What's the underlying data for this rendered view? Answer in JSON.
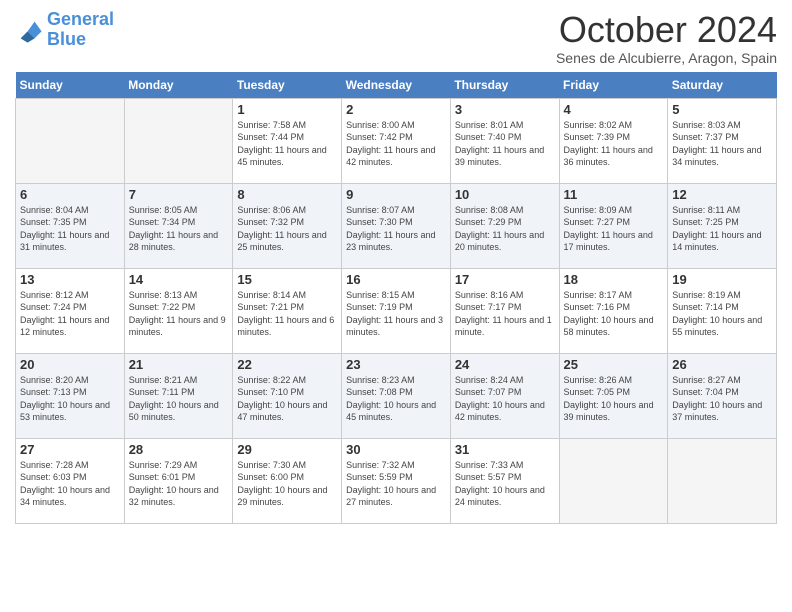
{
  "header": {
    "logo_line1": "General",
    "logo_line2": "Blue",
    "month": "October 2024",
    "location": "Senes de Alcubierre, Aragon, Spain"
  },
  "days_of_week": [
    "Sunday",
    "Monday",
    "Tuesday",
    "Wednesday",
    "Thursday",
    "Friday",
    "Saturday"
  ],
  "weeks": [
    [
      {
        "day": "",
        "sunrise": "",
        "sunset": "",
        "daylight": ""
      },
      {
        "day": "",
        "sunrise": "",
        "sunset": "",
        "daylight": ""
      },
      {
        "day": "1",
        "sunrise": "Sunrise: 7:58 AM",
        "sunset": "Sunset: 7:44 PM",
        "daylight": "Daylight: 11 hours and 45 minutes."
      },
      {
        "day": "2",
        "sunrise": "Sunrise: 8:00 AM",
        "sunset": "Sunset: 7:42 PM",
        "daylight": "Daylight: 11 hours and 42 minutes."
      },
      {
        "day": "3",
        "sunrise": "Sunrise: 8:01 AM",
        "sunset": "Sunset: 7:40 PM",
        "daylight": "Daylight: 11 hours and 39 minutes."
      },
      {
        "day": "4",
        "sunrise": "Sunrise: 8:02 AM",
        "sunset": "Sunset: 7:39 PM",
        "daylight": "Daylight: 11 hours and 36 minutes."
      },
      {
        "day": "5",
        "sunrise": "Sunrise: 8:03 AM",
        "sunset": "Sunset: 7:37 PM",
        "daylight": "Daylight: 11 hours and 34 minutes."
      }
    ],
    [
      {
        "day": "6",
        "sunrise": "Sunrise: 8:04 AM",
        "sunset": "Sunset: 7:35 PM",
        "daylight": "Daylight: 11 hours and 31 minutes."
      },
      {
        "day": "7",
        "sunrise": "Sunrise: 8:05 AM",
        "sunset": "Sunset: 7:34 PM",
        "daylight": "Daylight: 11 hours and 28 minutes."
      },
      {
        "day": "8",
        "sunrise": "Sunrise: 8:06 AM",
        "sunset": "Sunset: 7:32 PM",
        "daylight": "Daylight: 11 hours and 25 minutes."
      },
      {
        "day": "9",
        "sunrise": "Sunrise: 8:07 AM",
        "sunset": "Sunset: 7:30 PM",
        "daylight": "Daylight: 11 hours and 23 minutes."
      },
      {
        "day": "10",
        "sunrise": "Sunrise: 8:08 AM",
        "sunset": "Sunset: 7:29 PM",
        "daylight": "Daylight: 11 hours and 20 minutes."
      },
      {
        "day": "11",
        "sunrise": "Sunrise: 8:09 AM",
        "sunset": "Sunset: 7:27 PM",
        "daylight": "Daylight: 11 hours and 17 minutes."
      },
      {
        "day": "12",
        "sunrise": "Sunrise: 8:11 AM",
        "sunset": "Sunset: 7:25 PM",
        "daylight": "Daylight: 11 hours and 14 minutes."
      }
    ],
    [
      {
        "day": "13",
        "sunrise": "Sunrise: 8:12 AM",
        "sunset": "Sunset: 7:24 PM",
        "daylight": "Daylight: 11 hours and 12 minutes."
      },
      {
        "day": "14",
        "sunrise": "Sunrise: 8:13 AM",
        "sunset": "Sunset: 7:22 PM",
        "daylight": "Daylight: 11 hours and 9 minutes."
      },
      {
        "day": "15",
        "sunrise": "Sunrise: 8:14 AM",
        "sunset": "Sunset: 7:21 PM",
        "daylight": "Daylight: 11 hours and 6 minutes."
      },
      {
        "day": "16",
        "sunrise": "Sunrise: 8:15 AM",
        "sunset": "Sunset: 7:19 PM",
        "daylight": "Daylight: 11 hours and 3 minutes."
      },
      {
        "day": "17",
        "sunrise": "Sunrise: 8:16 AM",
        "sunset": "Sunset: 7:17 PM",
        "daylight": "Daylight: 11 hours and 1 minute."
      },
      {
        "day": "18",
        "sunrise": "Sunrise: 8:17 AM",
        "sunset": "Sunset: 7:16 PM",
        "daylight": "Daylight: 10 hours and 58 minutes."
      },
      {
        "day": "19",
        "sunrise": "Sunrise: 8:19 AM",
        "sunset": "Sunset: 7:14 PM",
        "daylight": "Daylight: 10 hours and 55 minutes."
      }
    ],
    [
      {
        "day": "20",
        "sunrise": "Sunrise: 8:20 AM",
        "sunset": "Sunset: 7:13 PM",
        "daylight": "Daylight: 10 hours and 53 minutes."
      },
      {
        "day": "21",
        "sunrise": "Sunrise: 8:21 AM",
        "sunset": "Sunset: 7:11 PM",
        "daylight": "Daylight: 10 hours and 50 minutes."
      },
      {
        "day": "22",
        "sunrise": "Sunrise: 8:22 AM",
        "sunset": "Sunset: 7:10 PM",
        "daylight": "Daylight: 10 hours and 47 minutes."
      },
      {
        "day": "23",
        "sunrise": "Sunrise: 8:23 AM",
        "sunset": "Sunset: 7:08 PM",
        "daylight": "Daylight: 10 hours and 45 minutes."
      },
      {
        "day": "24",
        "sunrise": "Sunrise: 8:24 AM",
        "sunset": "Sunset: 7:07 PM",
        "daylight": "Daylight: 10 hours and 42 minutes."
      },
      {
        "day": "25",
        "sunrise": "Sunrise: 8:26 AM",
        "sunset": "Sunset: 7:05 PM",
        "daylight": "Daylight: 10 hours and 39 minutes."
      },
      {
        "day": "26",
        "sunrise": "Sunrise: 8:27 AM",
        "sunset": "Sunset: 7:04 PM",
        "daylight": "Daylight: 10 hours and 37 minutes."
      }
    ],
    [
      {
        "day": "27",
        "sunrise": "Sunrise: 7:28 AM",
        "sunset": "Sunset: 6:03 PM",
        "daylight": "Daylight: 10 hours and 34 minutes."
      },
      {
        "day": "28",
        "sunrise": "Sunrise: 7:29 AM",
        "sunset": "Sunset: 6:01 PM",
        "daylight": "Daylight: 10 hours and 32 minutes."
      },
      {
        "day": "29",
        "sunrise": "Sunrise: 7:30 AM",
        "sunset": "Sunset: 6:00 PM",
        "daylight": "Daylight: 10 hours and 29 minutes."
      },
      {
        "day": "30",
        "sunrise": "Sunrise: 7:32 AM",
        "sunset": "Sunset: 5:59 PM",
        "daylight": "Daylight: 10 hours and 27 minutes."
      },
      {
        "day": "31",
        "sunrise": "Sunrise: 7:33 AM",
        "sunset": "Sunset: 5:57 PM",
        "daylight": "Daylight: 10 hours and 24 minutes."
      },
      {
        "day": "",
        "sunrise": "",
        "sunset": "",
        "daylight": ""
      },
      {
        "day": "",
        "sunrise": "",
        "sunset": "",
        "daylight": ""
      }
    ]
  ]
}
